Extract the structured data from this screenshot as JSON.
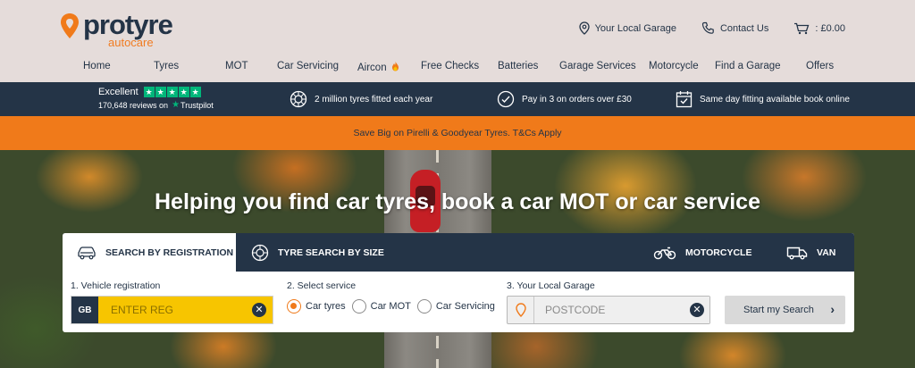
{
  "brand": {
    "name": "protyre",
    "tagline": "autocare",
    "color_primary": "#243447",
    "color_accent": "#f07a1a"
  },
  "header": {
    "links": [
      {
        "label": "Your Local Garage",
        "icon": "map-pin-icon"
      },
      {
        "label": "Contact Us",
        "icon": "phone-icon"
      },
      {
        "label": ": £0.00",
        "icon": "cart-icon"
      }
    ]
  },
  "nav": [
    "Home",
    "Tyres",
    "MOT",
    "Car Servicing",
    "Aircon",
    "Free Checks",
    "Batteries",
    "Garage Services",
    "Motorcycle",
    "Find a Garage",
    "Offers"
  ],
  "nav_aircon_icon": "fire-icon",
  "trust": {
    "rating_label": "Excellent",
    "reviews": "170,648 reviews on",
    "provider": "Trustpilot",
    "stars": 5,
    "usps": [
      {
        "label": "2 million tyres fitted each year",
        "icon": "tyre-icon"
      },
      {
        "label": "Pay in 3 on orders over £30",
        "icon": "clock-check-icon"
      },
      {
        "label": "Same day fitting available book online",
        "icon": "calendar-check-icon"
      }
    ]
  },
  "promo": "Save Big on Pirelli & Goodyear Tyres. T&Cs Apply",
  "hero": {
    "title": "Helping you find car tyres, book a car MOT or car service"
  },
  "search": {
    "tabs": [
      {
        "label": "SEARCH BY REGISTRATION",
        "icon": "car-icon",
        "active": true
      },
      {
        "label": "TYRE SEARCH BY SIZE",
        "icon": "tyre-icon",
        "active": false
      },
      {
        "label": "MOTORCYCLE",
        "icon": "motorcycle-icon",
        "active": false
      },
      {
        "label": "VAN",
        "icon": "van-icon",
        "active": false
      }
    ],
    "step1": {
      "label": "1. Vehicle registration",
      "prefix": "GB",
      "placeholder": "ENTER REG",
      "value": ""
    },
    "step2": {
      "label": "2. Select service",
      "options": [
        "Car tyres",
        "Car MOT",
        "Car Servicing"
      ],
      "selected": "Car tyres"
    },
    "step3": {
      "label": "3. Your Local Garage",
      "placeholder": "POSTCODE",
      "value": ""
    },
    "submit_label": "Start my Search"
  }
}
